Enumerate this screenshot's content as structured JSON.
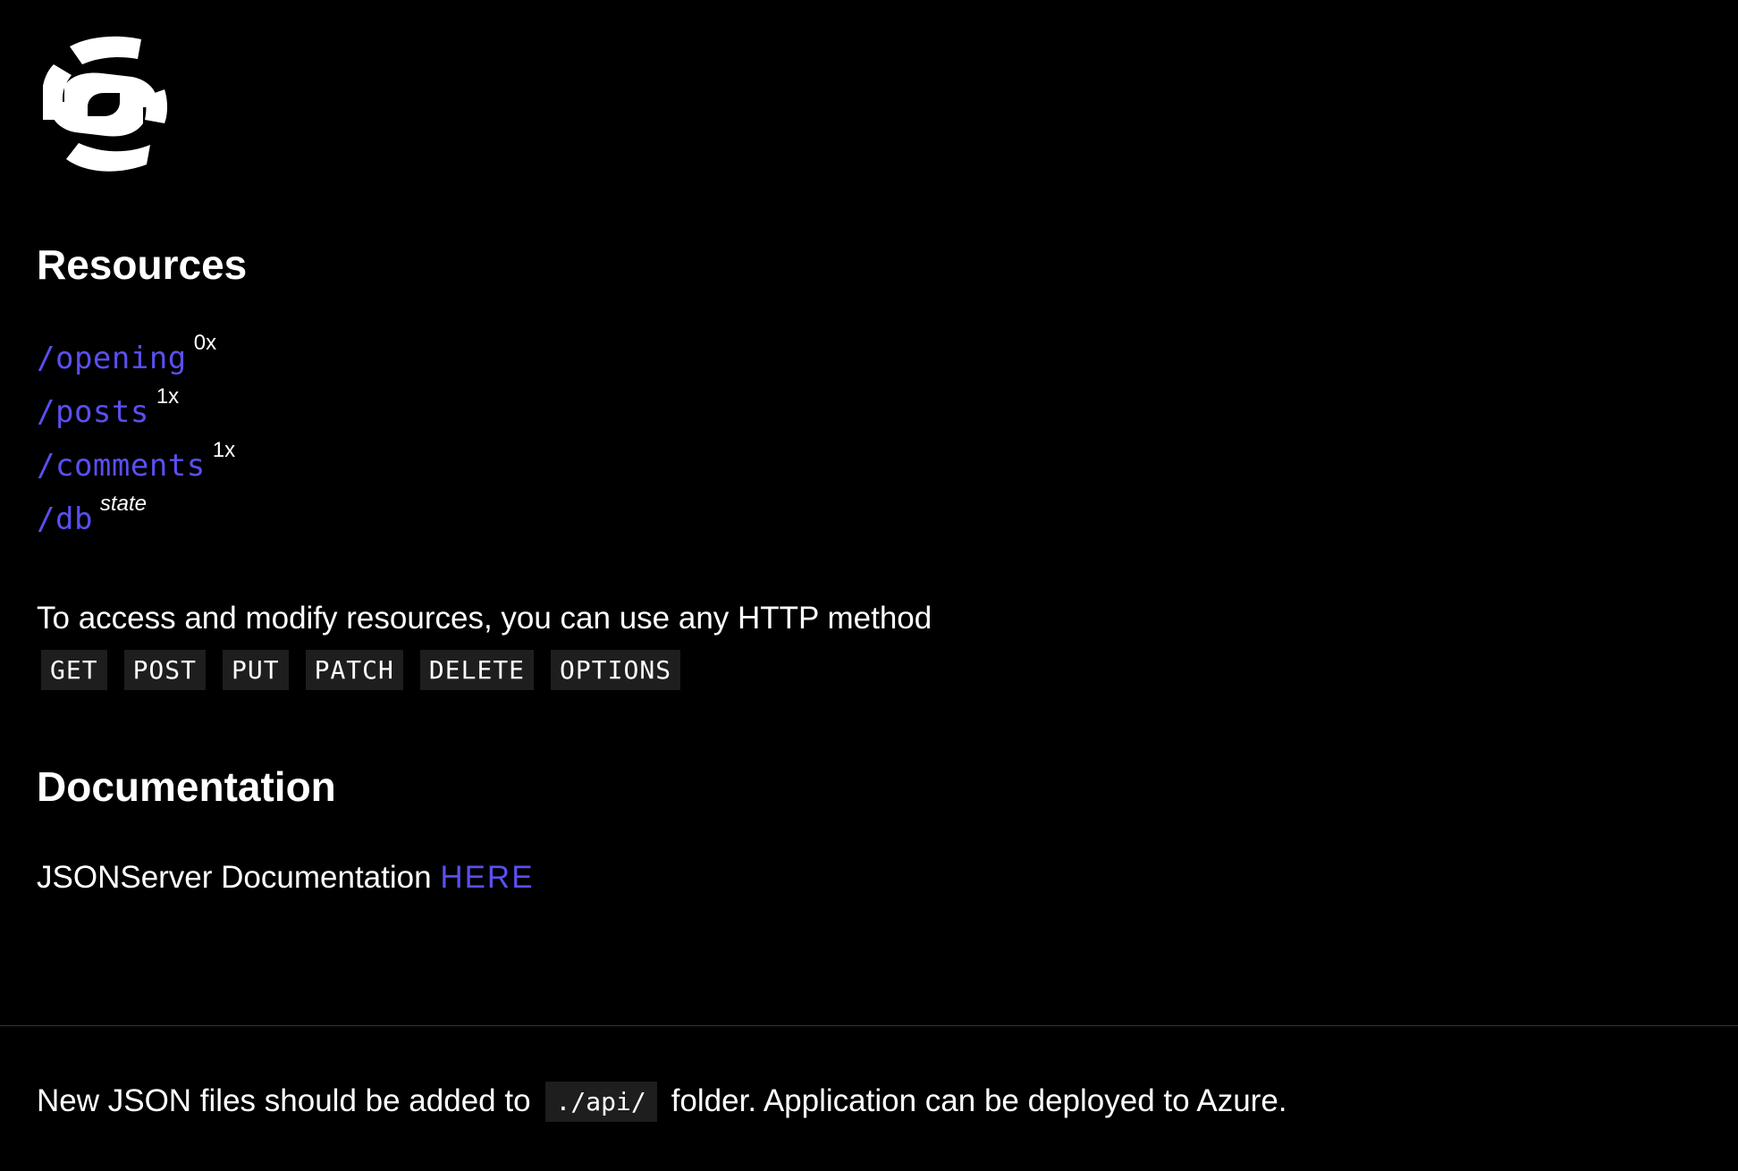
{
  "logo": {
    "name": "json-server-logo",
    "color": "#ffffff"
  },
  "resources": {
    "heading": "Resources",
    "items": [
      {
        "path": "/opening",
        "note": "0x"
      },
      {
        "path": "/posts",
        "note": "1x"
      },
      {
        "path": "/comments",
        "note": "1x"
      },
      {
        "path": "/db",
        "note": "state"
      }
    ],
    "intro": "To access and modify resources, you can use any HTTP method",
    "methods": [
      "GET",
      "POST",
      "PUT",
      "PATCH",
      "DELETE",
      "OPTIONS"
    ]
  },
  "documentation": {
    "heading": "Documentation",
    "text": "JSONServer Documentation",
    "link_label": "HERE"
  },
  "footer": {
    "text_before": "New JSON files should be added to",
    "code": "./api/",
    "text_after": "folder. Application can be deployed to Azure."
  },
  "colors": {
    "background": "#000000",
    "text": "#ffffff",
    "link": "#5a4ff0",
    "chip_background": "#1e1e1e"
  }
}
